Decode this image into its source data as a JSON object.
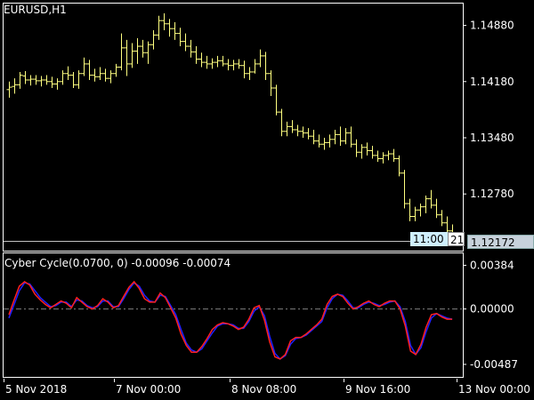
{
  "chart": {
    "symbol": "EURUSD,H1",
    "current_price": "1.12172",
    "countdown_time": "11:00",
    "countdown_value": "21",
    "colors": {
      "bars": "#ffff80",
      "background": "#000000",
      "axis": "#ffffff",
      "signal_up": "#ff2020",
      "signal_down": "#2020ff",
      "zero_line": "#808080"
    }
  },
  "price_axis": {
    "ticks": [
      "1.14880",
      "1.14180",
      "1.13480",
      "1.12780"
    ]
  },
  "indicator": {
    "label": "Cyber Cycle(0.0700, 0) -0.00096 -0.00074",
    "axis_ticks": [
      "0.00384",
      "0.00000",
      "-0.00487"
    ]
  },
  "time_axis": {
    "ticks": [
      "5 Nov 2018",
      "7 Nov 00:00",
      "8 Nov 08:00",
      "9 Nov 16:00",
      "13 Nov 00:00"
    ]
  },
  "chart_data": [
    {
      "type": "ohlc",
      "title": "EURUSD,H1",
      "ylim": [
        1.1214,
        1.1513
      ],
      "yticks": [
        1.1488,
        1.1418,
        1.1348,
        1.1278
      ],
      "bars": [
        [
          1.1408,
          1.1418,
          1.1398,
          1.1411
        ],
        [
          1.1412,
          1.1422,
          1.1403,
          1.1414
        ],
        [
          1.1414,
          1.143,
          1.1409,
          1.1426
        ],
        [
          1.1425,
          1.1431,
          1.1415,
          1.142
        ],
        [
          1.142,
          1.1426,
          1.1413,
          1.1421
        ],
        [
          1.1421,
          1.1426,
          1.1414,
          1.1419
        ],
        [
          1.1419,
          1.1425,
          1.1412,
          1.142
        ],
        [
          1.142,
          1.1426,
          1.1414,
          1.1418
        ],
        [
          1.1418,
          1.1424,
          1.141,
          1.1415
        ],
        [
          1.1415,
          1.1422,
          1.1408,
          1.1418
        ],
        [
          1.1418,
          1.1432,
          1.1414,
          1.1428
        ],
        [
          1.1428,
          1.1437,
          1.142,
          1.1426
        ],
        [
          1.1426,
          1.143,
          1.141,
          1.1414
        ],
        [
          1.1414,
          1.1432,
          1.1409,
          1.1428
        ],
        [
          1.1428,
          1.1448,
          1.1425,
          1.144
        ],
        [
          1.144,
          1.1445,
          1.142,
          1.1426
        ],
        [
          1.1426,
          1.1434,
          1.1418,
          1.1424
        ],
        [
          1.1424,
          1.1436,
          1.142,
          1.1428
        ],
        [
          1.1428,
          1.1434,
          1.1418,
          1.1422
        ],
        [
          1.1422,
          1.1432,
          1.1416,
          1.1428
        ],
        [
          1.1428,
          1.144,
          1.1424,
          1.1436
        ],
        [
          1.1436,
          1.1478,
          1.1432,
          1.146
        ],
        [
          1.146,
          1.147,
          1.1425,
          1.144
        ],
        [
          1.144,
          1.1466,
          1.1435,
          1.1456
        ],
        [
          1.1456,
          1.1472,
          1.144,
          1.1462
        ],
        [
          1.1462,
          1.147,
          1.1448,
          1.1454
        ],
        [
          1.1454,
          1.1468,
          1.144,
          1.1464
        ],
        [
          1.1464,
          1.1482,
          1.1458,
          1.1476
        ],
        [
          1.1476,
          1.15,
          1.147,
          1.1494
        ],
        [
          1.1494,
          1.1503,
          1.1482,
          1.149
        ],
        [
          1.149,
          1.1496,
          1.1474,
          1.1484
        ],
        [
          1.1484,
          1.1492,
          1.147,
          1.1478
        ],
        [
          1.1478,
          1.1485,
          1.1462,
          1.1468
        ],
        [
          1.1468,
          1.1478,
          1.1456,
          1.1462
        ],
        [
          1.1462,
          1.147,
          1.1448,
          1.1455
        ],
        [
          1.1455,
          1.1462,
          1.144,
          1.1446
        ],
        [
          1.1446,
          1.1454,
          1.1436,
          1.1442
        ],
        [
          1.1442,
          1.145,
          1.1434,
          1.144
        ],
        [
          1.144,
          1.1447,
          1.1434,
          1.1442
        ],
        [
          1.1442,
          1.145,
          1.1436,
          1.1444
        ],
        [
          1.1444,
          1.145,
          1.1437,
          1.144
        ],
        [
          1.144,
          1.1446,
          1.1432,
          1.1438
        ],
        [
          1.1438,
          1.1445,
          1.1432,
          1.144
        ],
        [
          1.144,
          1.1446,
          1.1434,
          1.1438
        ],
        [
          1.1438,
          1.1444,
          1.1422,
          1.1428
        ],
        [
          1.1428,
          1.1436,
          1.142,
          1.143
        ],
        [
          1.143,
          1.1446,
          1.1428,
          1.144
        ],
        [
          1.144,
          1.1458,
          1.1436,
          1.145
        ],
        [
          1.145,
          1.1455,
          1.142,
          1.1428
        ],
        [
          1.1428,
          1.1432,
          1.14,
          1.141
        ],
        [
          1.141,
          1.1414,
          1.1376,
          1.138
        ],
        [
          1.138,
          1.1384,
          1.135,
          1.1356
        ],
        [
          1.1356,
          1.1368,
          1.135,
          1.1362
        ],
        [
          1.1362,
          1.137,
          1.1354,
          1.1358
        ],
        [
          1.1358,
          1.1364,
          1.135,
          1.1356
        ],
        [
          1.1356,
          1.1362,
          1.1348,
          1.1354
        ],
        [
          1.1354,
          1.136,
          1.1346,
          1.135
        ],
        [
          1.135,
          1.1358,
          1.134,
          1.1344
        ],
        [
          1.1344,
          1.1352,
          1.1336,
          1.134
        ],
        [
          1.134,
          1.1348,
          1.1333,
          1.1342
        ],
        [
          1.1342,
          1.1352,
          1.1336,
          1.1346
        ],
        [
          1.1346,
          1.1358,
          1.134,
          1.1352
        ],
        [
          1.1352,
          1.1362,
          1.1338,
          1.1344
        ],
        [
          1.1344,
          1.136,
          1.134,
          1.1354
        ],
        [
          1.1354,
          1.1362,
          1.1336,
          1.134
        ],
        [
          1.134,
          1.1346,
          1.1324,
          1.133
        ],
        [
          1.133,
          1.134,
          1.1322,
          1.1336
        ],
        [
          1.1336,
          1.1342,
          1.1326,
          1.1332
        ],
        [
          1.1332,
          1.1338,
          1.1322,
          1.1326
        ],
        [
          1.1326,
          1.1332,
          1.1318,
          1.1322
        ],
        [
          1.1322,
          1.133,
          1.1316,
          1.1326
        ],
        [
          1.1326,
          1.1332,
          1.132,
          1.1328
        ],
        [
          1.1328,
          1.1334,
          1.1318,
          1.1322
        ],
        [
          1.1322,
          1.1326,
          1.13,
          1.1304
        ],
        [
          1.1304,
          1.1308,
          1.126,
          1.1266
        ],
        [
          1.1266,
          1.1272,
          1.1244,
          1.125
        ],
        [
          1.125,
          1.1262,
          1.1244,
          1.1258
        ],
        [
          1.1258,
          1.1266,
          1.125,
          1.1262
        ],
        [
          1.1262,
          1.1276,
          1.1254,
          1.1272
        ],
        [
          1.1272,
          1.1283,
          1.126,
          1.1264
        ],
        [
          1.1264,
          1.1272,
          1.1248,
          1.1252
        ],
        [
          1.1252,
          1.1258,
          1.1238,
          1.1242
        ],
        [
          1.1242,
          1.125,
          1.1226,
          1.1232
        ],
        [
          1.1232,
          1.124,
          1.1222,
          1.1228
        ]
      ]
    },
    {
      "type": "line",
      "title": "Cyber Cycle(0.0700, 0) -0.00096 -0.00074",
      "ylim": [
        -0.0055,
        0.0045
      ],
      "yticks": [
        0.00384,
        0.0,
        -0.00487
      ],
      "series": [
        {
          "name": "",
          "color": "#ff2020",
          "values": [
            -0.0005,
            0.0008,
            0.002,
            0.0024,
            0.0021,
            0.0013,
            0.0008,
            0.0004,
            0.0001,
            0.0004,
            0.0007,
            0.0005,
            0.0001,
            0.001,
            0.0006,
            0.0002,
            0.0,
            0.0003,
            0.0009,
            0.0006,
            0.0001,
            0.0003,
            0.0011,
            0.0019,
            0.0024,
            0.0018,
            0.0009,
            0.0006,
            0.0006,
            0.0014,
            0.001,
            0.0001,
            -0.0008,
            -0.0022,
            -0.0032,
            -0.0038,
            -0.0038,
            -0.0033,
            -0.0026,
            -0.0018,
            -0.0014,
            -0.0012,
            -0.0013,
            -0.0015,
            -0.0018,
            -0.0016,
            -0.0009,
            0.0001,
            0.0003,
            -0.001,
            -0.0029,
            -0.0042,
            -0.0044,
            -0.004,
            -0.0028,
            -0.0025,
            -0.0025,
            -0.0022,
            -0.0018,
            -0.0014,
            -0.0009,
            0.0004,
            0.0011,
            0.0013,
            0.0011,
            0.0005,
            0.0,
            0.0002,
            0.0005,
            0.0007,
            0.0004,
            0.0002,
            0.0005,
            0.0007,
            0.0007,
            0.0,
            -0.0015,
            -0.0037,
            -0.004,
            -0.0031,
            -0.0016,
            -0.0005,
            -0.0004,
            -0.0007,
            -0.0009,
            -0.0009
          ]
        },
        {
          "name": "",
          "color": "#2020ff",
          "values": [
            -0.0008,
            0.0004,
            0.0016,
            0.0023,
            0.0022,
            0.0016,
            0.001,
            0.0006,
            0.0002,
            0.0003,
            0.0006,
            0.0006,
            0.0002,
            0.0008,
            0.0007,
            0.0003,
            0.0001,
            0.0002,
            0.0007,
            0.0007,
            0.0002,
            0.0002,
            0.0009,
            0.0017,
            0.0023,
            0.002,
            0.0012,
            0.0007,
            0.0006,
            0.0012,
            0.0011,
            0.0003,
            -0.0005,
            -0.0018,
            -0.003,
            -0.0036,
            -0.0038,
            -0.0035,
            -0.0028,
            -0.0021,
            -0.0015,
            -0.0013,
            -0.0013,
            -0.0014,
            -0.0017,
            -0.0017,
            -0.0011,
            -0.0002,
            0.0002,
            -0.0006,
            -0.0024,
            -0.0039,
            -0.0044,
            -0.0041,
            -0.0031,
            -0.0026,
            -0.0025,
            -0.0023,
            -0.0019,
            -0.0015,
            -0.0011,
            0.0001,
            0.0009,
            0.0013,
            0.0012,
            0.0007,
            0.0001,
            0.0001,
            0.0004,
            0.0006,
            0.0005,
            0.0003,
            0.0004,
            0.0006,
            0.0007,
            0.0002,
            -0.0011,
            -0.0032,
            -0.004,
            -0.0034,
            -0.002,
            -0.0008,
            -0.0004,
            -0.0006,
            -0.0008,
            -0.0009
          ]
        }
      ]
    }
  ]
}
